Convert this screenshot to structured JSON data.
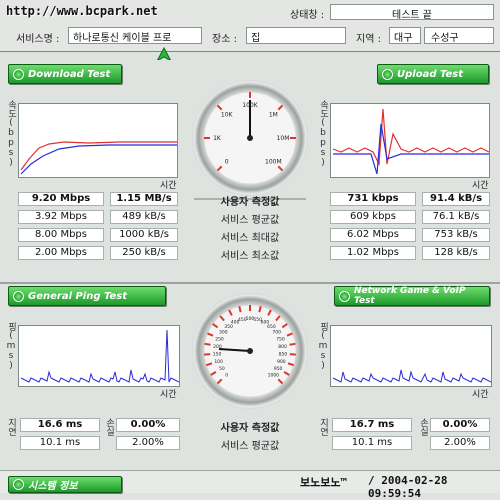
{
  "header": {
    "url": "http://www.bcpark.net",
    "status_label": "상태창 :",
    "status_value": "테스트 끝",
    "provider_label": "서비스명 :",
    "provider_value": "하나로통신 케이블 프로",
    "place_label": "장소 :",
    "place_value": "집",
    "region_label": "지역 :",
    "region_city": "대구",
    "region_district": "수성구"
  },
  "download": {
    "button": "Download Test",
    "ylabel": "속도(bps)",
    "xlabel": "시간"
  },
  "upload": {
    "button": "Upload Test",
    "ylabel": "속도(bps)",
    "xlabel": "시간"
  },
  "speed_gauge": {
    "ticks": [
      "0",
      "1K",
      "10K",
      "100K",
      "1M",
      "10M",
      "100M"
    ]
  },
  "speed_table": {
    "labels": [
      "사용자 측정값",
      "서비스 평균값",
      "서비스 최대값",
      "서비스 최소값"
    ],
    "download": [
      [
        "9.20 Mbps",
        "1.15 MB/s"
      ],
      [
        "3.92 Mbps",
        "489 kB/s"
      ],
      [
        "8.00 Mbps",
        "1000 kB/s"
      ],
      [
        "2.00 Mbps",
        "250 kB/s"
      ]
    ],
    "upload": [
      [
        "731 kbps",
        "91.4 kB/s"
      ],
      [
        "609 kbps",
        "76.1 kB/s"
      ],
      [
        "6.02 Mbps",
        "753 kB/s"
      ],
      [
        "1.02 Mbps",
        "128 kB/s"
      ]
    ]
  },
  "ping": {
    "button": "General Ping Test",
    "ylabel": "핑(ms)",
    "xlabel": "시간",
    "delay_label": "지연",
    "loss_label": "손실"
  },
  "game": {
    "button": "Network Game & VoIP Test",
    "ylabel": "핑(ms)",
    "xlabel": "시간",
    "delay_label": "지연",
    "loss_label": "손실"
  },
  "ping_gauge": {
    "ticks": [
      "0",
      "50",
      "100",
      "150",
      "200",
      "250",
      "300",
      "350",
      "400",
      "450",
      "500",
      "550",
      "600",
      "650",
      "700",
      "750",
      "800",
      "850",
      "900",
      "950",
      "1000"
    ]
  },
  "ping_table": {
    "labels": [
      "사용자 측정값",
      "서비스 평균값"
    ],
    "ping": [
      [
        "16.6 ms",
        "0.00%"
      ],
      [
        "10.1 ms",
        "2.00%"
      ]
    ],
    "game": [
      [
        "16.7 ms",
        "0.00%"
      ],
      [
        "10.1 ms",
        "2.00%"
      ]
    ]
  },
  "footer": {
    "button": "시스템 정보",
    "brand": "보노보노™",
    "datetime": "/ 2004-02-28 09:59:54"
  },
  "colors": {
    "accent_green": "#1d9a2a",
    "download_red": "#e03030",
    "download_blue": "#2b2bd8",
    "gauge_tick_red": "#d83a2a"
  }
}
